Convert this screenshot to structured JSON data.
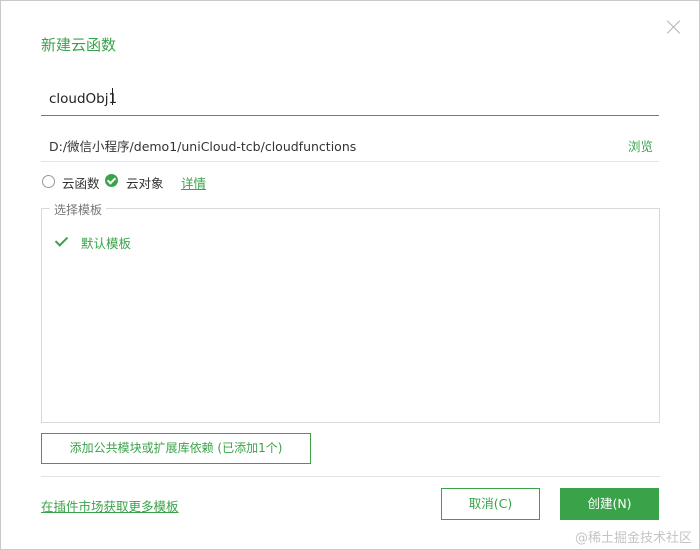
{
  "dialog": {
    "title": "新建云函数",
    "close_icon": "close-icon"
  },
  "name_field": {
    "value": "cloudObj1"
  },
  "path_row": {
    "path": "D:/微信小程序/demo1/uniCloud-tcb/cloudfunctions",
    "browse_label": "浏览"
  },
  "type_options": {
    "cloud_function_label": "云函数",
    "cloud_object_label": "云对象",
    "selected": "云对象",
    "detail_link": "详情"
  },
  "templates": {
    "legend": "选择模板",
    "items": [
      {
        "label": "默认模板",
        "selected": true
      }
    ]
  },
  "add_module_button": "添加公共模块或扩展库依赖 (已添加1个)",
  "plugin_market_link": "在插件市场获取更多模板",
  "buttons": {
    "cancel": "取消(C)",
    "create": "创建(N)"
  },
  "watermark": "@稀土掘金技术社区",
  "colors": {
    "accent": "#3aa34a",
    "border": "#d9d9d9"
  }
}
